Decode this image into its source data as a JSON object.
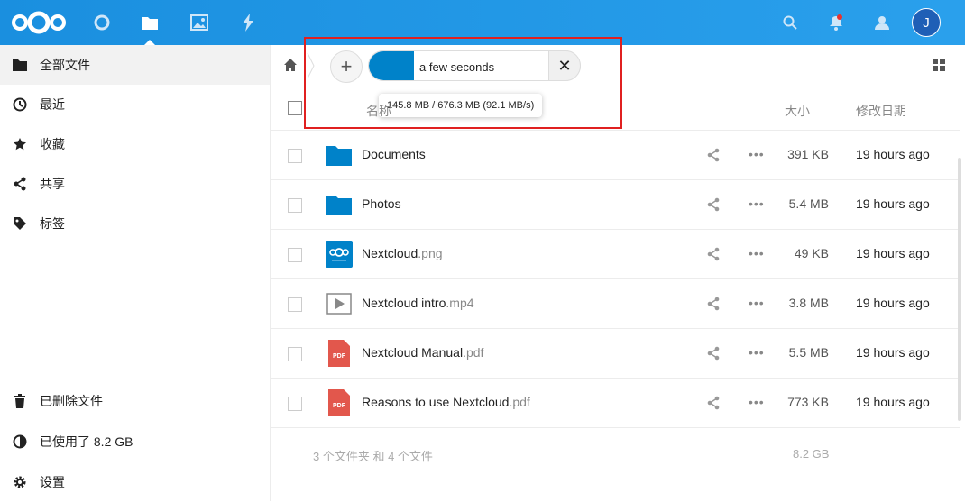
{
  "header": {
    "accent": "#1a8fdf",
    "apps": [
      {
        "name": "dashboard",
        "icon": "circle-icon"
      },
      {
        "name": "files",
        "icon": "folder-icon"
      },
      {
        "name": "photos",
        "icon": "image-icon"
      },
      {
        "name": "activity",
        "icon": "lightning-icon"
      }
    ],
    "user_initial": "J"
  },
  "sidebar": {
    "items": [
      {
        "label": "全部文件",
        "icon": "folder-icon"
      },
      {
        "label": "最近",
        "icon": "clock-icon"
      },
      {
        "label": "收藏",
        "icon": "star-icon"
      },
      {
        "label": "共享",
        "icon": "share-icon"
      },
      {
        "label": "标签",
        "icon": "tag-icon"
      }
    ],
    "bottom": [
      {
        "label": "已删除文件",
        "icon": "trash-icon"
      },
      {
        "label": "已使用了 8.2 GB",
        "icon": "quota-pie-icon"
      },
      {
        "label": "设置",
        "icon": "gear-icon"
      }
    ]
  },
  "upload": {
    "add_label": "+",
    "eta": "a few seconds",
    "progress": 0.215,
    "tooltip": "145.8 MB / 676.3 MB (92.1 MB/s)",
    "cancel_label": "✕"
  },
  "table": {
    "headers": {
      "name": "名称",
      "size": "大小",
      "modified": "修改日期"
    },
    "rows": [
      {
        "base": "Documents",
        "ext": "",
        "type": "folder",
        "size": "391 KB",
        "date": "19 hours ago"
      },
      {
        "base": "Photos",
        "ext": "",
        "type": "folder",
        "size": "5.4 MB",
        "date": "19 hours ago"
      },
      {
        "base": "Nextcloud",
        "ext": ".png",
        "type": "image",
        "size": "49 KB",
        "date": "19 hours ago"
      },
      {
        "base": "Nextcloud intro",
        "ext": ".mp4",
        "type": "video",
        "size": "3.8 MB",
        "date": "19 hours ago"
      },
      {
        "base": "Nextcloud Manual",
        "ext": ".pdf",
        "type": "pdf",
        "size": "5.5 MB",
        "date": "19 hours ago"
      },
      {
        "base": "Reasons to use Nextcloud",
        "ext": ".pdf",
        "type": "pdf",
        "size": "773 KB",
        "date": "19 hours ago"
      }
    ],
    "summary": {
      "label": "3 个文件夹 和 4 个文件",
      "size": "8.2 GB"
    },
    "more_label": "•••"
  }
}
